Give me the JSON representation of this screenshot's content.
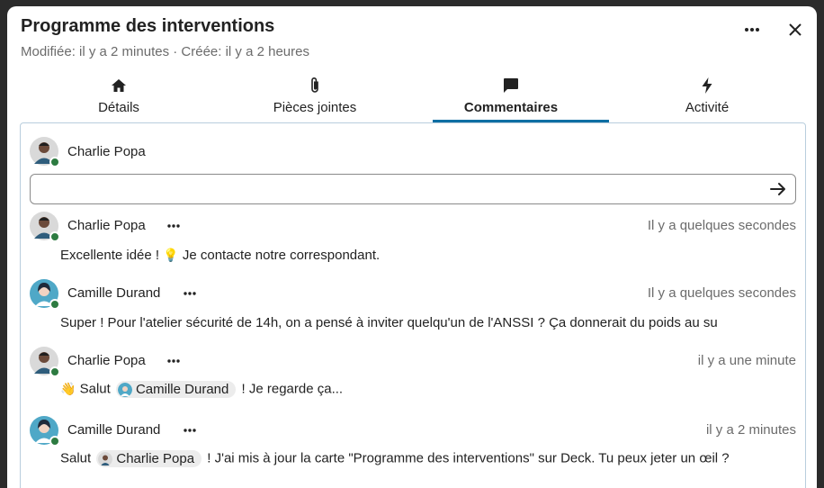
{
  "header": {
    "title": "Programme des interventions",
    "subtitle": "Modifiée: il y a 2 minutes · Créée: il y a 2 heures"
  },
  "tabs": [
    {
      "label": "Détails",
      "icon": "home-icon"
    },
    {
      "label": "Pièces jointes",
      "icon": "paperclip-icon"
    },
    {
      "label": "Commentaires",
      "icon": "comment-icon"
    },
    {
      "label": "Activité",
      "icon": "lightning-icon"
    }
  ],
  "active_tab": "Commentaires",
  "composer": {
    "author": "Charlie Popa",
    "placeholder": ""
  },
  "comments": [
    {
      "author": "Charlie Popa",
      "time": "Il y a quelques secondes",
      "text_before": "Excellente idée ! ",
      "emoji": "💡",
      "text_after": " Je contacte notre correspondant."
    },
    {
      "author": "Camille Durand",
      "time": "Il y a quelques secondes",
      "text": "Super ! Pour l'atelier sécurité de 14h, on a pensé à inviter quelqu'un de l'ANSSI ? Ça donnerait du poids au su"
    },
    {
      "author": "Charlie Popa",
      "time": "il y a une minute",
      "emoji": "👋",
      "text_before": " Salut ",
      "mention": "Camille Durand",
      "text_after": " ! Je regarde ça..."
    },
    {
      "author": "Camille Durand",
      "time": "il y a 2 minutes",
      "text_before": "Salut ",
      "mention": "Charlie Popa",
      "text_after": " ! J'ai mis à jour la carte \"Programme des interventions\" sur Deck. Tu peux jeter un œil ?"
    }
  ],
  "colors": {
    "accent": "#0e6ea3",
    "online": "#2d7b41",
    "muted_text": "#6b6b6b"
  }
}
